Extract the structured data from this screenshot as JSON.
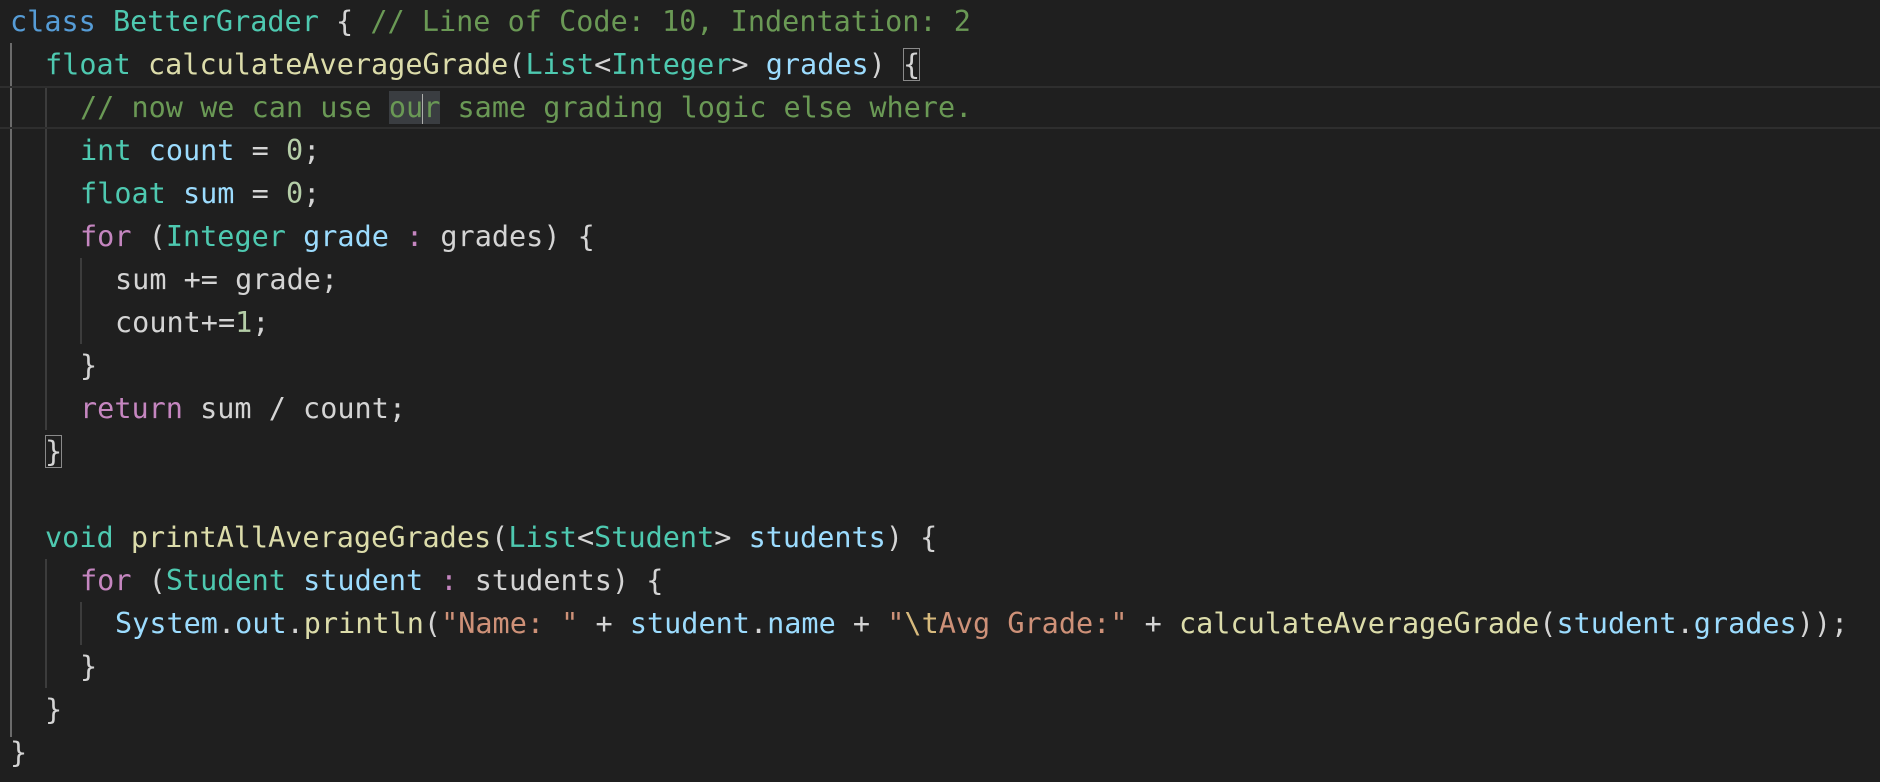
{
  "editor": {
    "language": "java",
    "theme": "dark",
    "cursor": {
      "line": 3,
      "column": 16
    },
    "highlighted_word": "our",
    "colors": {
      "background": "#1f1f1f",
      "keyword": "#569cd6",
      "type": "#4ec9b0",
      "control": "#c586c0",
      "function": "#dcdcaa",
      "variable": "#9cdcfe",
      "comment": "#6a9955",
      "number": "#b5cea8",
      "string": "#ce9178",
      "escape": "#d7ba7d",
      "plain": "#d4d4d4"
    },
    "lines": [
      {
        "tokens": [
          {
            "t": "class",
            "c": "kw"
          },
          {
            "t": " "
          },
          {
            "t": "BetterGrader",
            "c": "type"
          },
          {
            "t": " { "
          },
          {
            "t": "// Line of Code: 10, Indentation: 2",
            "c": "cm"
          }
        ]
      },
      {
        "tokens": [
          {
            "t": "float",
            "c": "type"
          },
          {
            "t": " "
          },
          {
            "t": "calculateAverageGrade",
            "c": "fn"
          },
          {
            "t": "("
          },
          {
            "t": "List",
            "c": "type"
          },
          {
            "t": "<"
          },
          {
            "t": "Integer",
            "c": "type"
          },
          {
            "t": "> "
          },
          {
            "t": "grades",
            "c": "var"
          },
          {
            "t": ") "
          },
          {
            "t": "{",
            "box": true
          }
        ]
      },
      {
        "tokens": [
          {
            "t": "// now we can use ",
            "c": "cm"
          },
          {
            "t": "ou",
            "c": "cm",
            "hl": true
          },
          {
            "t": "|",
            "caret": true
          },
          {
            "t": "r",
            "c": "cm",
            "hl": true
          },
          {
            "t": " same grading logic else where.",
            "c": "cm"
          }
        ]
      },
      {
        "tokens": [
          {
            "t": "int",
            "c": "type"
          },
          {
            "t": " "
          },
          {
            "t": "count",
            "c": "var"
          },
          {
            "t": " = "
          },
          {
            "t": "0",
            "c": "num"
          },
          {
            "t": ";"
          }
        ]
      },
      {
        "tokens": [
          {
            "t": "float",
            "c": "type"
          },
          {
            "t": " "
          },
          {
            "t": "sum",
            "c": "var"
          },
          {
            "t": " = "
          },
          {
            "t": "0",
            "c": "num"
          },
          {
            "t": ";"
          }
        ]
      },
      {
        "tokens": [
          {
            "t": "for",
            "c": "ctrl"
          },
          {
            "t": " ("
          },
          {
            "t": "Integer",
            "c": "type"
          },
          {
            "t": " "
          },
          {
            "t": "grade",
            "c": "var"
          },
          {
            "t": " : ",
            "c": "ctrl"
          },
          {
            "t": "grades) {"
          }
        ]
      },
      {
        "tokens": [
          {
            "t": "sum += grade;"
          }
        ]
      },
      {
        "tokens": [
          {
            "t": "count+="
          },
          {
            "t": "1",
            "c": "num"
          },
          {
            "t": ";"
          }
        ]
      },
      {
        "tokens": [
          {
            "t": "}"
          }
        ]
      },
      {
        "tokens": [
          {
            "t": "return",
            "c": "ctrl"
          },
          {
            "t": " sum / count;"
          }
        ]
      },
      {
        "tokens": [
          {
            "t": "}",
            "box": true
          }
        ]
      },
      {
        "tokens": []
      },
      {
        "tokens": [
          {
            "t": "void",
            "c": "type"
          },
          {
            "t": " "
          },
          {
            "t": "printAllAverageGrades",
            "c": "fn"
          },
          {
            "t": "("
          },
          {
            "t": "List",
            "c": "type"
          },
          {
            "t": "<"
          },
          {
            "t": "Student",
            "c": "type"
          },
          {
            "t": "> "
          },
          {
            "t": "students",
            "c": "var"
          },
          {
            "t": ") {"
          }
        ]
      },
      {
        "tokens": [
          {
            "t": "for",
            "c": "ctrl"
          },
          {
            "t": " ("
          },
          {
            "t": "Student",
            "c": "type"
          },
          {
            "t": " "
          },
          {
            "t": "student",
            "c": "var"
          },
          {
            "t": " : ",
            "c": "ctrl"
          },
          {
            "t": "students) {"
          }
        ]
      },
      {
        "tokens": [
          {
            "t": "System",
            "c": "var"
          },
          {
            "t": "."
          },
          {
            "t": "out",
            "c": "var"
          },
          {
            "t": "."
          },
          {
            "t": "println",
            "c": "fn"
          },
          {
            "t": "("
          },
          {
            "t": "\"Name: \"",
            "c": "str"
          },
          {
            "t": " + "
          },
          {
            "t": "student",
            "c": "var"
          },
          {
            "t": "."
          },
          {
            "t": "name",
            "c": "var"
          },
          {
            "t": " + "
          },
          {
            "t": "\"",
            "c": "str"
          },
          {
            "t": "\\t",
            "c": "esc"
          },
          {
            "t": "Avg Grade:\"",
            "c": "str"
          },
          {
            "t": " + "
          },
          {
            "t": "calculateAverageGrade",
            "c": "fn"
          },
          {
            "t": "("
          },
          {
            "t": "student",
            "c": "var"
          },
          {
            "t": "."
          },
          {
            "t": "grades",
            "c": "var"
          },
          {
            "t": "));"
          }
        ]
      },
      {
        "tokens": [
          {
            "t": "}"
          }
        ]
      },
      {
        "tokens": [
          {
            "t": "}"
          }
        ]
      },
      {
        "tokens": [
          {
            "t": "}"
          }
        ]
      }
    ]
  }
}
